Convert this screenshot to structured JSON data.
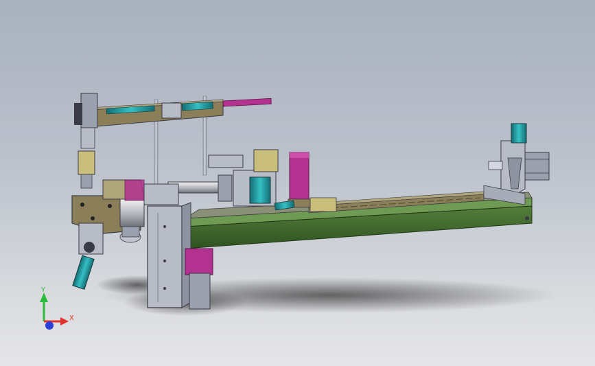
{
  "scene": {
    "background_top": "#a9b1bf",
    "background_bottom": "#e6e6e8"
  },
  "triad": {
    "x_label": "X",
    "y_label": "Y",
    "x_color": "#e0322b",
    "y_color": "#2dbb3c",
    "z_color": "#2a3fd6"
  },
  "model": {
    "frame_color": "#3e6b2c",
    "rail_color": "#8a7f58",
    "accent_magenta": "#b3318f",
    "accent_teal": "#1e9aa0",
    "metal_color": "#b7bcc7",
    "dark_color": "#3b3b45"
  }
}
